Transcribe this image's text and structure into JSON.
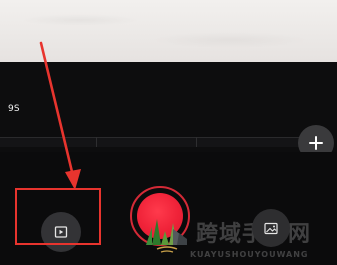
{
  "timeline": {
    "duration": "9S"
  },
  "controls": {
    "add_clip_icon": "plus-icon",
    "preview_icon": "play-preview-icon",
    "record_icon": "record-button",
    "gallery_icon": "gallery-image-icon"
  },
  "colors": {
    "record_red": "#ef2238",
    "annotation_red": "#e8342e",
    "background": "#0c0c0d"
  },
  "watermark": {
    "logo_text": "跨域手游网",
    "sub_text": "KUAYUSHOUYOUWANG"
  }
}
